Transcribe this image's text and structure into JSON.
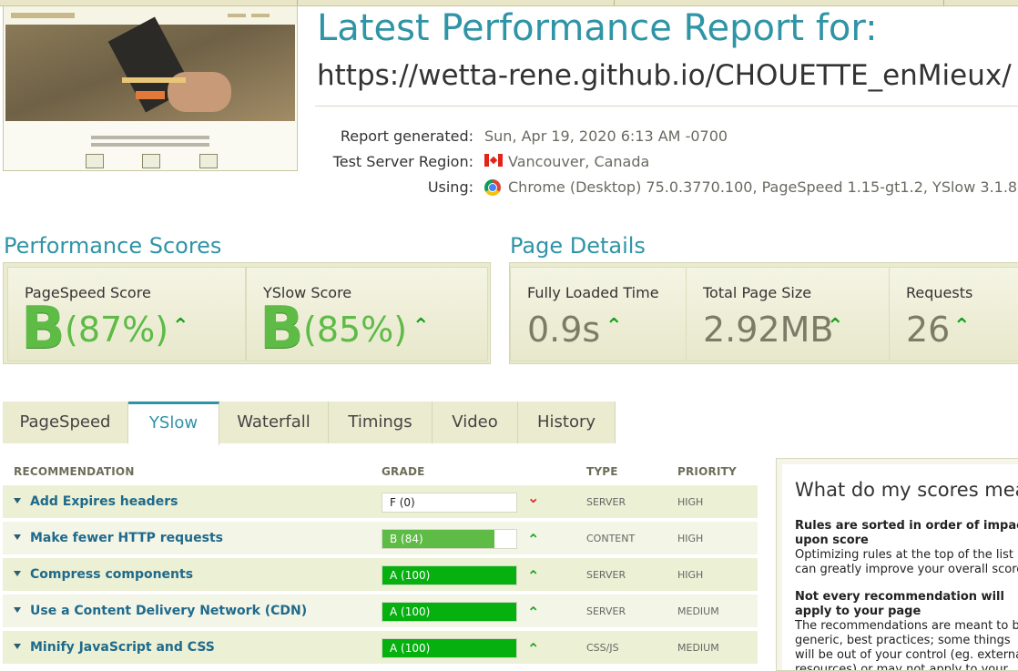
{
  "header": {
    "title": "Latest Performance Report for:",
    "url": "https://wetta-rene.github.io/CHOUETTE_enMieux/"
  },
  "meta": {
    "report_generated_label": "Report generated:",
    "report_generated_value": "Sun, Apr 19, 2020 6:13 AM -0700",
    "region_label": "Test Server Region:",
    "region_value": "Vancouver, Canada",
    "using_label": "Using:",
    "using_value": "Chrome (Desktop) 75.0.3770.100, PageSpeed 1.15-gt1.2, YSlow 3.1.8"
  },
  "performance_scores": {
    "title": "Performance Scores",
    "pagespeed": {
      "label": "PageSpeed Score",
      "grade": "B",
      "percent": "(87%)"
    },
    "yslow": {
      "label": "YSlow Score",
      "grade": "B",
      "percent": "(85%)"
    }
  },
  "page_details": {
    "title": "Page Details",
    "fully_loaded": {
      "label": "Fully Loaded Time",
      "value": "0.9s"
    },
    "page_size": {
      "label": "Total Page Size",
      "value": "2.92MB"
    },
    "requests": {
      "label": "Requests",
      "value": "26"
    }
  },
  "tabs": [
    {
      "label": "PageSpeed",
      "active": false
    },
    {
      "label": "YSlow",
      "active": true
    },
    {
      "label": "Waterfall",
      "active": false
    },
    {
      "label": "Timings",
      "active": false
    },
    {
      "label": "Video",
      "active": false
    },
    {
      "label": "History",
      "active": false
    }
  ],
  "yslow_table": {
    "headers": {
      "recommendation": "RECOMMENDATION",
      "grade": "GRADE",
      "type": "TYPE",
      "priority": "PRIORITY"
    },
    "rows": [
      {
        "recommendation": "Add Expires headers",
        "grade": "F (0)",
        "score": 0,
        "trend": "down",
        "type": "SERVER",
        "priority": "HIGH"
      },
      {
        "recommendation": "Make fewer HTTP requests",
        "grade": "B (84)",
        "score": 84,
        "trend": "up",
        "type": "CONTENT",
        "priority": "HIGH"
      },
      {
        "recommendation": "Compress components",
        "grade": "A (100)",
        "score": 100,
        "trend": "up",
        "type": "SERVER",
        "priority": "HIGH"
      },
      {
        "recommendation": "Use a Content Delivery Network (CDN)",
        "grade": "A (100)",
        "score": 100,
        "trend": "up",
        "type": "SERVER",
        "priority": "MEDIUM"
      },
      {
        "recommendation": "Minify JavaScript and CSS",
        "grade": "A (100)",
        "score": 100,
        "trend": "up",
        "type": "CSS/JS",
        "priority": "MEDIUM"
      }
    ]
  },
  "side_panel": {
    "title": "What do my scores mean",
    "h1": "Rules are sorted in order of impact upon score",
    "p1": "Optimizing rules at the top of the list can greatly improve your overall score.",
    "h2": "Not every recommendation will apply to your page",
    "p2": "The recommendations are meant to be generic, best practices; some things will be out of your control (eg. external resources) or may not apply to your page."
  },
  "colors": {
    "accent": "#2f94a6",
    "grade_b": "#5dbb46",
    "grade_a": "#05b00f",
    "trend_up": "#17a01e",
    "trend_down": "#e02020"
  },
  "icons": [
    "canada-flag-icon",
    "chrome-icon",
    "up-arrow-icon",
    "down-arrow-icon",
    "caret-down-icon"
  ]
}
